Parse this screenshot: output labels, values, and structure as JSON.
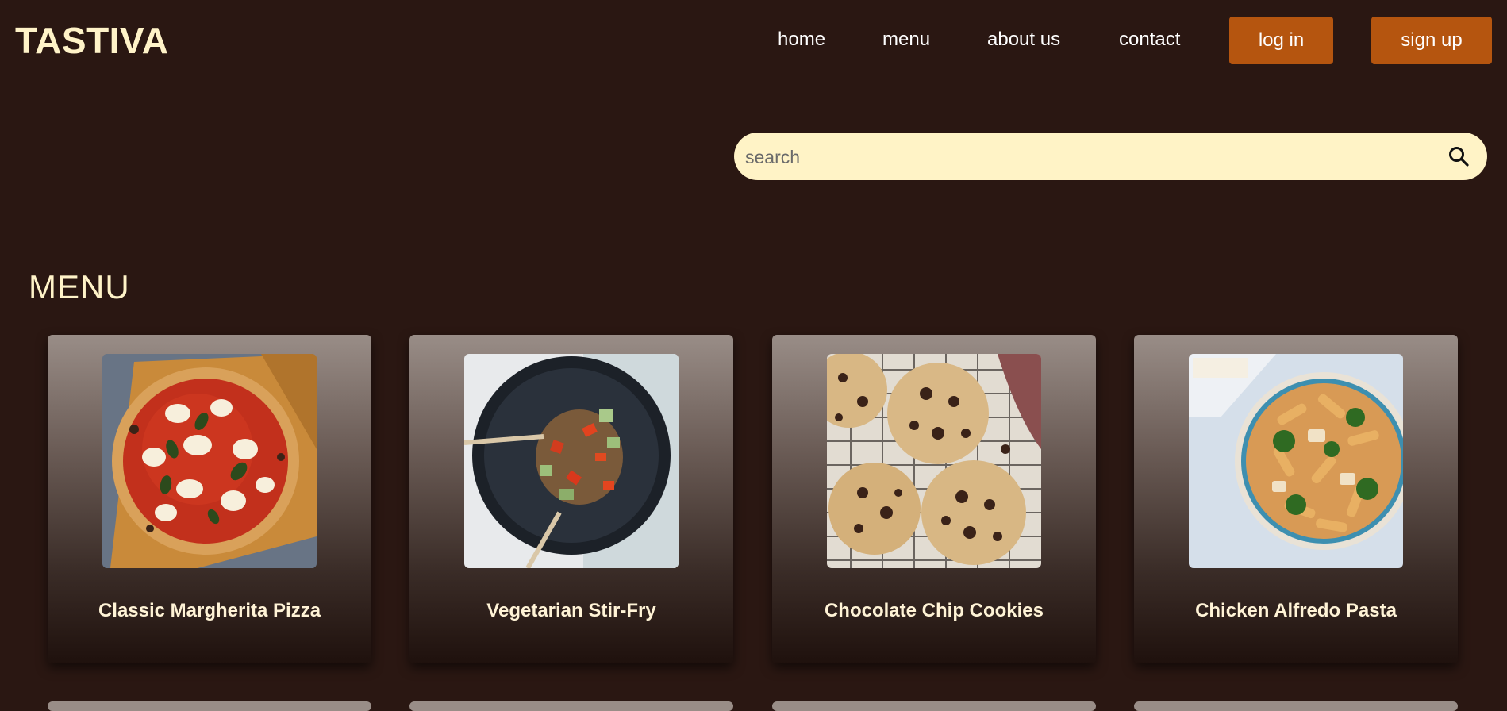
{
  "brand": {
    "name": "TASTIVA"
  },
  "nav": {
    "links": [
      "home",
      "menu",
      "about us",
      "contact"
    ],
    "login_label": "log in",
    "signup_label": "sign up"
  },
  "search": {
    "placeholder": "search",
    "value": ""
  },
  "menu_section": {
    "title": "MENU",
    "items": [
      {
        "name": "Classic Margherita Pizza",
        "image": "pizza-photo"
      },
      {
        "name": "Vegetarian Stir-Fry",
        "image": "stir-fry-photo"
      },
      {
        "name": "Chocolate Chip Cookies",
        "image": "cookies-photo"
      },
      {
        "name": "Chicken Alfredo Pasta",
        "image": "pasta-photo"
      }
    ]
  },
  "colors": {
    "background": "#2a1712",
    "accent": "#b5550f",
    "cream": "#fff3c6"
  },
  "icons": {
    "search": "search-icon"
  }
}
